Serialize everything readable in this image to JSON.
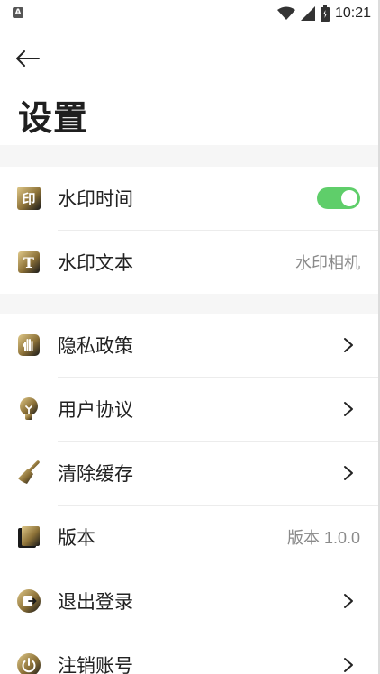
{
  "status": {
    "time": "10:21",
    "left_glyph": "A"
  },
  "nav": {
    "back_icon": "arrow-left-icon"
  },
  "page": {
    "title": "设置"
  },
  "settings": {
    "watermark_time": {
      "label": "水印时间",
      "toggle_on": true,
      "icon": "seal-icon"
    },
    "watermark_text": {
      "label": "水印文本",
      "value": "水印相机",
      "icon": "text-t-icon"
    },
    "privacy": {
      "label": "隐私政策",
      "icon": "hand-icon"
    },
    "user_agreement": {
      "label": "用户协议",
      "icon": "bulb-icon"
    },
    "clear_cache": {
      "label": "清除缓存",
      "icon": "broom-icon"
    },
    "version": {
      "label": "版本",
      "value": "版本 1.0.0",
      "icon": "book-icon"
    },
    "logout": {
      "label": "退出登录",
      "icon": "exit-icon"
    },
    "delete_account": {
      "label": "注销账号",
      "icon": "power-icon"
    }
  },
  "colors": {
    "toggle_on": "#5fce6a",
    "icon_gold": "#b89a4e",
    "icon_dark": "#1a1a1a"
  }
}
